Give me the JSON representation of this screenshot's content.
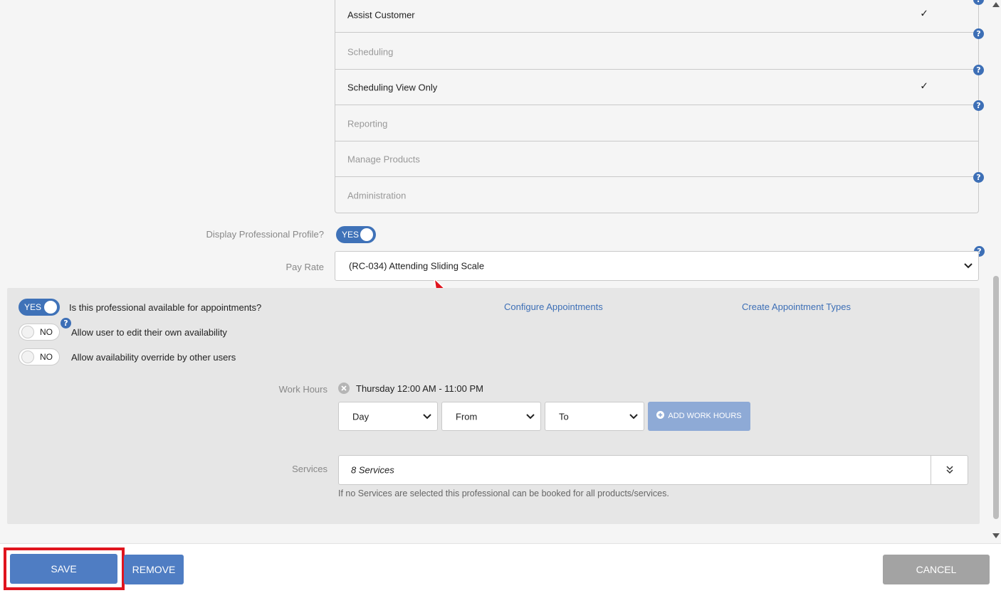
{
  "permissions": [
    {
      "label": "Assist Customer",
      "checked": true
    },
    {
      "label": "Scheduling",
      "checked": false
    },
    {
      "label": "Scheduling View Only",
      "checked": true
    },
    {
      "label": "Reporting",
      "checked": false
    },
    {
      "label": "Manage Products",
      "checked": false
    },
    {
      "label": "Administration",
      "checked": false
    }
  ],
  "check_mark": "✓",
  "help_glyph": "?",
  "profile": {
    "display_profile_label": "Display Professional Profile?",
    "display_profile_toggle": "YES",
    "pay_rate_label": "Pay Rate",
    "pay_rate_value": "(RC-034) Attending Sliding Scale"
  },
  "availability": {
    "available_toggle": "YES",
    "available_text": "Is this professional available for appointments?",
    "edit_own_toggle": "NO",
    "edit_own_text": "Allow user to edit their own availability",
    "override_toggle": "NO",
    "override_text": "Allow availability override by other users",
    "configure_link": "Configure Appointments",
    "create_types_link": "Create Appointment Types"
  },
  "work_hours": {
    "label": "Work Hours",
    "entry": "Thursday 12:00 AM - 11:00 PM",
    "day_placeholder": "Day",
    "from_placeholder": "From",
    "to_placeholder": "To",
    "add_button": "ADD WORK HOURS"
  },
  "services": {
    "label": "Services",
    "value": "8 Services",
    "hint": "If no Services are selected this professional can be booked for all products/services."
  },
  "footer": {
    "save": "SAVE",
    "remove": "REMOVE",
    "cancel": "CANCEL"
  },
  "colors": {
    "primary": "#4f7dc3",
    "toggle_on": "#3f72b8",
    "disabled_button": "#8eaad6",
    "cancel": "#a3a3a3",
    "highlight": "#e0141e",
    "link": "#3d6fb6"
  }
}
